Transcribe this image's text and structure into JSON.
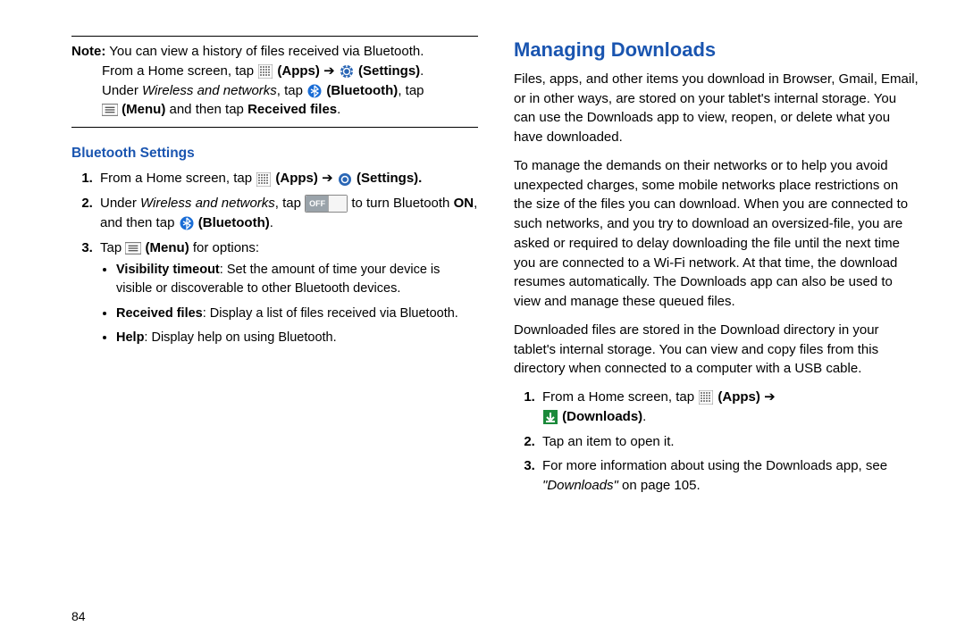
{
  "left": {
    "note": {
      "label": "Note:",
      "line1": " You can view a history of files received via Bluetooth.",
      "line2a": "From a Home screen, tap ",
      "apps_label": "(Apps)",
      "arrow": " ➔ ",
      "settings_label": "(Settings)",
      "line3a": "Under ",
      "italic1": "Wireless and networks",
      "line3b": ", tap ",
      "bt_label": "(Bluetooth)",
      "line3c": ", tap",
      "menu_label": "(Menu)",
      "line4a": " and then tap ",
      "received_label": "Received files",
      "line4b": "."
    },
    "subhead": "Bluetooth Settings",
    "step1": {
      "a": "From a Home screen, tap ",
      "apps": "(Apps)",
      "arrow": " ➔ ",
      "settings": "(Settings)."
    },
    "step2": {
      "a": "Under ",
      "ital": "Wireless and networks",
      "b": ", tap ",
      "toggle": "OFF",
      "c": " to turn Bluetooth ",
      "on": "ON",
      "d": ", and then tap ",
      "bt": "(Bluetooth)",
      "e": "."
    },
    "step3": {
      "a": "Tap ",
      "menu": "(Menu)",
      "b": " for options:"
    },
    "bullets": {
      "b1a": "Visibility timeout",
      "b1b": ": Set the amount of time your device is visible or discoverable to other Bluetooth devices.",
      "b2a": "Received files",
      "b2b": ": Display a list of files received via Bluetooth.",
      "b3a": "Help",
      "b3b": ": Display help on using Bluetooth."
    }
  },
  "right": {
    "heading": "Managing Downloads",
    "p1": "Files, apps, and other items you download in Browser, Gmail, Email, or in other ways, are stored on your tablet's internal storage. You can use the Downloads app to view, reopen, or delete what you have downloaded.",
    "p2": "To manage the demands on their networks or to help you avoid unexpected charges, some mobile networks place restrictions on the size of the files you can download. When you are connected to such networks, and you try to download an oversized-file, you are asked or required to delay downloading the file until the next time you are connected to a Wi-Fi network. At that time, the download resumes automatically. The Downloads app can also be used to view and manage these queued files.",
    "p3": "Downloaded files are stored in the Download directory in your tablet's internal storage. You can view and copy files from this directory when connected to a computer with a USB cable.",
    "step1": {
      "a": "From a Home screen, tap ",
      "apps": "(Apps)",
      "arrow": " ➔",
      "downloads": "(Downloads)",
      "dot": "."
    },
    "step2": "Tap an item to open it.",
    "step3": {
      "a": "For more information about using the Downloads app, see ",
      "ital": "\"Downloads\"",
      "b": " on page 105."
    }
  },
  "page_number": "84"
}
